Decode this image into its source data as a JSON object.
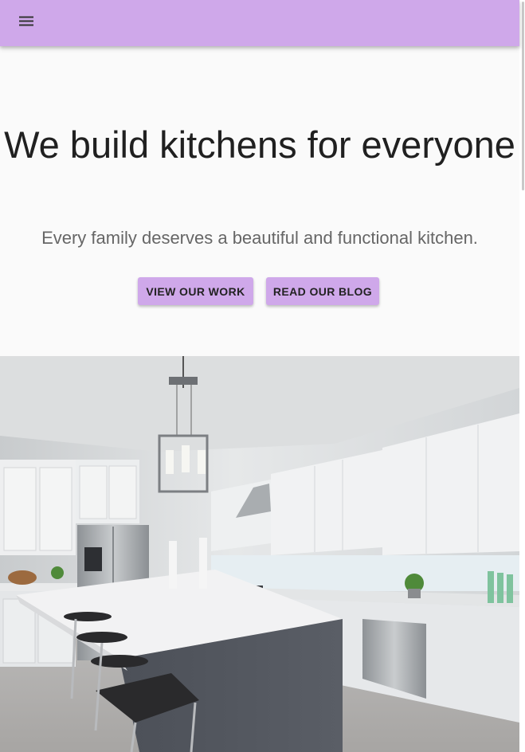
{
  "appbar": {
    "menu_icon": "hamburger-menu-icon",
    "color": "#cfa8ea"
  },
  "hero": {
    "title": "We build kitchens for everyone",
    "subtitle": "Every family deserves a beautiful and functional kitchen.",
    "buttons": [
      {
        "label": "VIEW OUR WORK"
      },
      {
        "label": "READ OUR BLOG"
      }
    ]
  },
  "image": {
    "subject": "kitchen-photo"
  }
}
